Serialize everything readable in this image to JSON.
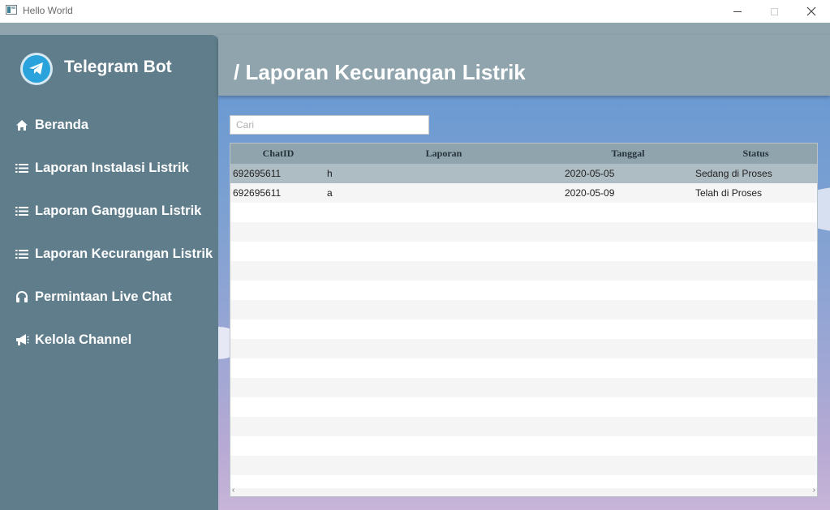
{
  "window": {
    "title": "Hello World"
  },
  "sidebar": {
    "brand": "Telegram Bot",
    "items": [
      {
        "label": "Beranda",
        "icon": "home-icon"
      },
      {
        "label": "Laporan Instalasi Listrik",
        "icon": "list-icon"
      },
      {
        "label": "Laporan Gangguan Listrik",
        "icon": "list-icon"
      },
      {
        "label": "Laporan Kecurangan Listrik",
        "icon": "list-icon"
      },
      {
        "label": "Permintaan Live Chat",
        "icon": "headphones-icon"
      },
      {
        "label": "Kelola Channel",
        "icon": "bullhorn-icon"
      }
    ]
  },
  "header": {
    "title": "/ Laporan Kecurangan Listrik"
  },
  "search": {
    "placeholder": "Cari",
    "value": ""
  },
  "table": {
    "columns": [
      "ChatID",
      "Laporan",
      "Tanggal",
      "Status"
    ],
    "rows": [
      {
        "chatid": "692695611",
        "laporan": "h",
        "tanggal": "2020-05-05",
        "status": "Sedang di Proses",
        "selected": true
      },
      {
        "chatid": "692695611",
        "laporan": "a",
        "tanggal": "2020-05-09",
        "status": "Telah di Proses",
        "selected": false
      }
    ]
  },
  "colors": {
    "sidebar": "#607d8b",
    "header": "#90a4ad",
    "accent_telegram": "#2aa3dc",
    "selected_row": "#aebcc3"
  }
}
